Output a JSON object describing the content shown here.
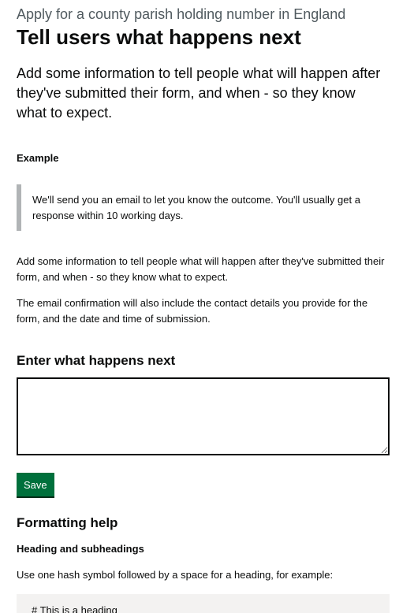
{
  "header": {
    "caption": "Apply for a county parish holding number in England",
    "title": "Tell users what happens next"
  },
  "intro": {
    "lead": "Add some information to tell people what will happen after they've submitted their form, and when - so they know what to expect."
  },
  "example": {
    "label": "Example",
    "inset_text": "We'll send you an email to let you know the outcome. You'll usually get a response within 10 working days."
  },
  "guidance": {
    "paragraph_1": "Add some information to tell people what will happen after they've submitted their form, and when - so they know what to expect.",
    "paragraph_2": "The email confirmation will also include the contact details you provide for the form, and the date and time of submission."
  },
  "form": {
    "field_label": "Enter what happens next",
    "field_value": "",
    "save_label": "Save"
  },
  "formatting_help": {
    "title": "Formatting help",
    "subheading": "Heading and subheadings",
    "text": "Use one hash symbol followed by a space for a heading, for example:",
    "code_example": "# This is a heading"
  },
  "colors": {
    "button": "#00703c",
    "inset_border": "#b1b4b6",
    "code_background": "#f3f2f1",
    "caption": "#505a5f"
  }
}
